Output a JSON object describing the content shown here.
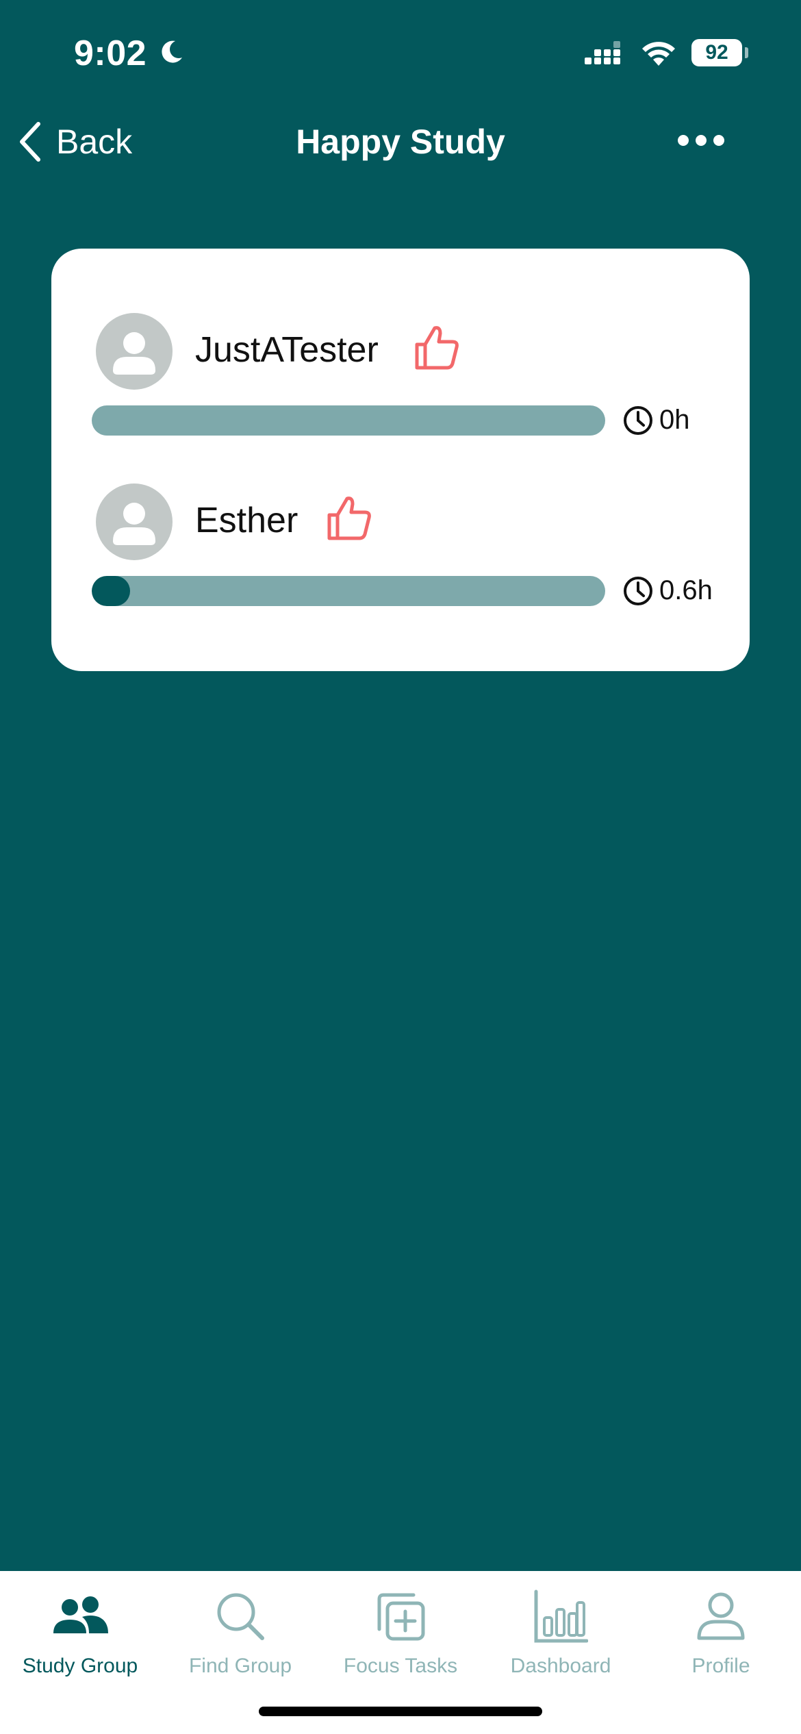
{
  "status_bar": {
    "time": "9:02",
    "battery": "92",
    "icons": [
      "moon-icon",
      "signal-icon",
      "wifi-icon",
      "battery-icon"
    ]
  },
  "nav": {
    "back_label": "Back",
    "title": "Happy Study",
    "more_icon": "more-icon"
  },
  "members": [
    {
      "name": "JustATester",
      "duration": "0h",
      "progress": 0.0,
      "like_icon": "thumbs-up-icon"
    },
    {
      "name": "Esther",
      "duration": "0.6h",
      "progress": 0.075,
      "like_icon": "thumbs-up-icon"
    }
  ],
  "tabs": [
    {
      "label": "Study Group",
      "icon": "people-icon",
      "active": true
    },
    {
      "label": "Find Group",
      "icon": "search-icon",
      "active": false
    },
    {
      "label": "Focus Tasks",
      "icon": "add-task-icon",
      "active": false
    },
    {
      "label": "Dashboard",
      "icon": "bar-chart-icon",
      "active": false
    },
    {
      "label": "Profile",
      "icon": "person-icon",
      "active": false
    }
  ],
  "colors": {
    "background": "#03585c",
    "card": "#ffffff",
    "progress_track": "#7ea9ab",
    "progress_fill": "#03585c",
    "like": "#f2686a",
    "tab_inactive": "#8fb5b6",
    "tab_active": "#03585c"
  }
}
